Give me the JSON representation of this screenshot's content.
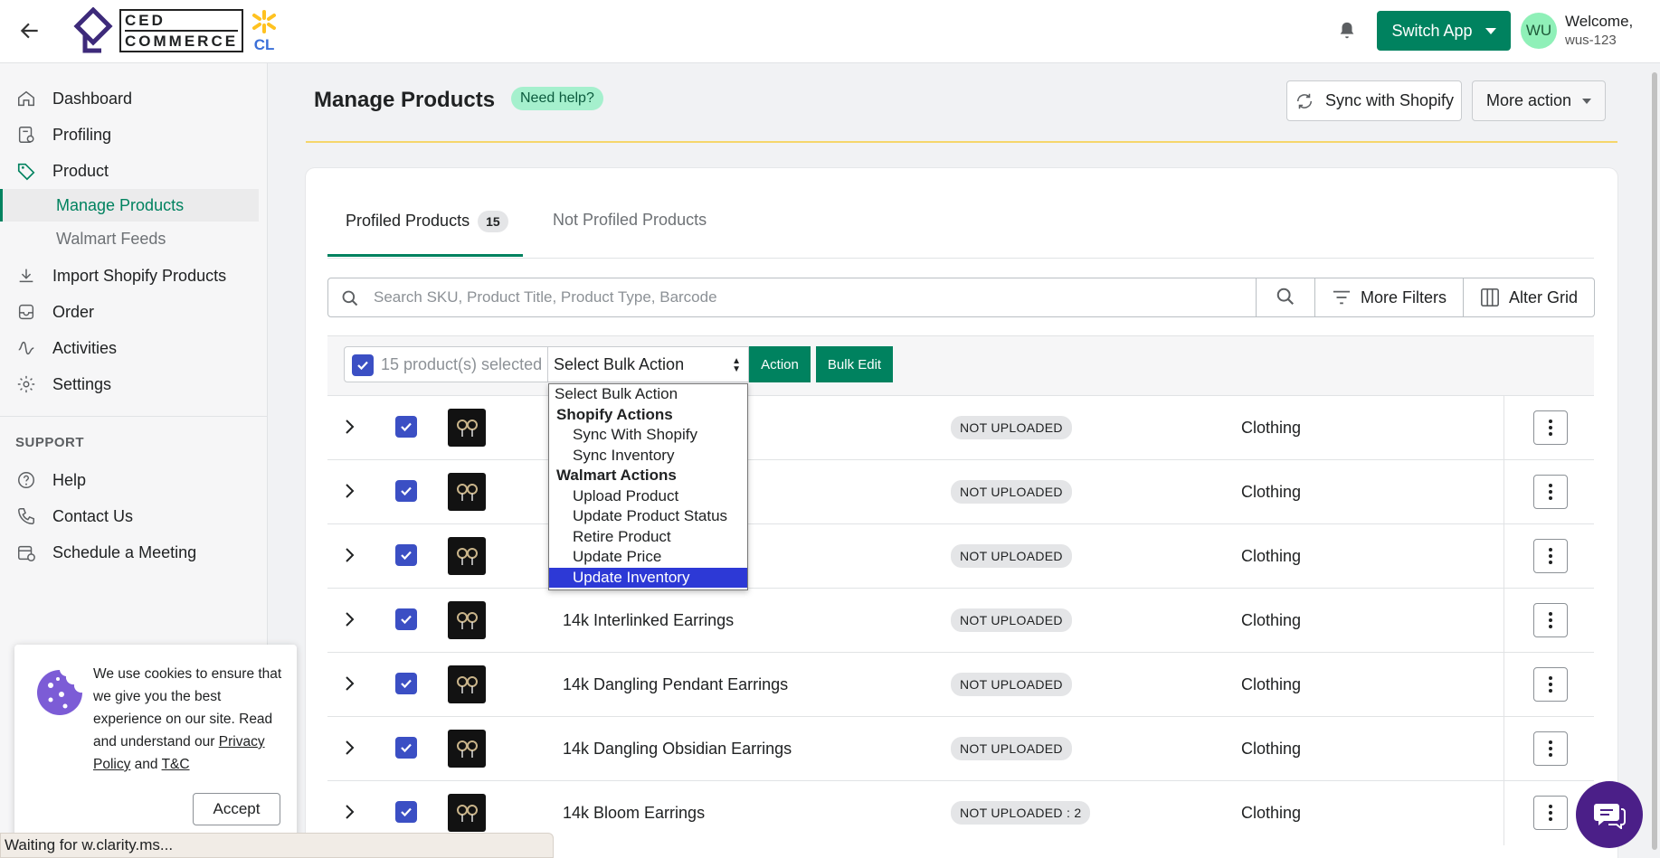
{
  "header": {
    "logo_top": "CED",
    "logo_bottom": "COMMERCE",
    "logo_badge": "CL",
    "switch_app_label": "Switch App",
    "avatar_initials": "WU",
    "welcome": "Welcome,",
    "username": "wus-123"
  },
  "sidebar": {
    "items": [
      {
        "label": "Dashboard",
        "icon": "home-icon"
      },
      {
        "label": "Profiling",
        "icon": "profile-icon"
      },
      {
        "label": "Product",
        "icon": "tag-icon"
      },
      {
        "label": "Import Shopify Products",
        "icon": "download-icon"
      },
      {
        "label": "Order",
        "icon": "inbox-icon"
      },
      {
        "label": "Activities",
        "icon": "activity-icon"
      },
      {
        "label": "Settings",
        "icon": "gear-icon"
      }
    ],
    "sub_items": [
      "Manage Products",
      "Walmart Feeds"
    ],
    "support_heading": "SUPPORT",
    "support_items": [
      {
        "label": "Help",
        "icon": "help-icon"
      },
      {
        "label": "Contact Us",
        "icon": "phone-icon"
      },
      {
        "label": "Schedule a Meeting",
        "icon": "calendar-icon"
      }
    ]
  },
  "page": {
    "title": "Manage Products",
    "need_help": "Need help?",
    "sync_label": "Sync with Shopify",
    "more_action_label": "More action"
  },
  "tabs": {
    "profiled_label": "Profiled Products",
    "profiled_count": "15",
    "not_profiled_label": "Not Profiled Products"
  },
  "search": {
    "placeholder": "Search SKU, Product Title, Product Type, Barcode",
    "more_filters": "More Filters",
    "alter_grid": "Alter Grid"
  },
  "bulk": {
    "selected_text": "15 product(s) selected",
    "select_value": "Select Bulk Action",
    "action_label": "Action",
    "bulk_edit_label": "Bulk Edit",
    "options": [
      {
        "label": "Select Bulk Action",
        "kind": "option"
      },
      {
        "label": "Shopify Actions",
        "kind": "group"
      },
      {
        "label": "Sync With Shopify",
        "kind": "sub"
      },
      {
        "label": "Sync Inventory",
        "kind": "sub"
      },
      {
        "label": "Walmart Actions",
        "kind": "group"
      },
      {
        "label": "Upload Product",
        "kind": "sub"
      },
      {
        "label": "Update Product Status",
        "kind": "sub"
      },
      {
        "label": "Retire Product",
        "kind": "sub"
      },
      {
        "label": "Update Price",
        "kind": "sub"
      },
      {
        "label": "Update Inventory",
        "kind": "sub",
        "selected": true
      }
    ]
  },
  "products": [
    {
      "name": "",
      "status": "NOT UPLOADED",
      "type": "Clothing"
    },
    {
      "name": "",
      "status": "NOT UPLOADED",
      "type": "Clothing"
    },
    {
      "name": "",
      "status": "NOT UPLOADED",
      "type": "Clothing"
    },
    {
      "name": "14k Interlinked Earrings",
      "status": "NOT UPLOADED",
      "type": "Clothing"
    },
    {
      "name": "14k Dangling Pendant Earrings",
      "status": "NOT UPLOADED",
      "type": "Clothing"
    },
    {
      "name": "14k Dangling Obsidian Earrings",
      "status": "NOT UPLOADED",
      "type": "Clothing"
    },
    {
      "name": "14k Bloom Earrings",
      "status": "NOT UPLOADED : 2",
      "type": "Clothing"
    }
  ],
  "cookie": {
    "text_before": "We use cookies to ensure that we give you the best experience on our site. Read and understand our ",
    "privacy_link": "Privacy Policy",
    "and": " and ",
    "tc_link": "T&C",
    "accept": "Accept"
  },
  "status_bar": "Waiting for w.clarity.ms...",
  "colors": {
    "brand_green": "#00825f",
    "checkbox_blue": "#3b4fc4",
    "dropdown_highlight": "#2d39d6",
    "chat_purple": "#4b1f88"
  }
}
